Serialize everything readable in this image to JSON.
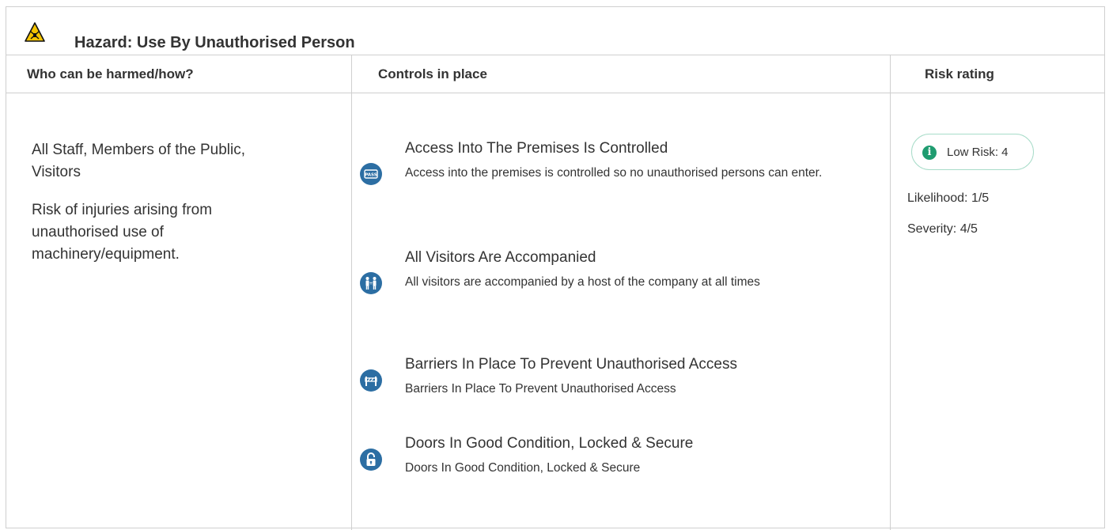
{
  "hazard": {
    "icon": "warning-triangle-icon",
    "title": "Hazard:  Use By Unauthorised Person"
  },
  "columns": {
    "who": "Who can be harmed/how?",
    "controls": "Controls in place",
    "risk": "Risk rating"
  },
  "who": {
    "people": "All Staff, Members of the Public, Visitors",
    "how": "Risk of injuries arising from unauthorised use of machinery/equipment."
  },
  "controls": [
    {
      "icon": "pass-card-icon",
      "title": "Access Into The Premises Is Controlled",
      "description": "Access into the premises is controlled so no unauthorised persons can enter."
    },
    {
      "icon": "accompanied-visitors-icon",
      "title": "All Visitors Are Accompanied",
      "description": "All visitors are accompanied by a host of the company at all times"
    },
    {
      "icon": "barrier-icon",
      "title": "Barriers In Place To Prevent Unauthorised Access",
      "description": "Barriers In Place To Prevent Unauthorised Access"
    },
    {
      "icon": "padlock-icon",
      "title": "Doors In Good Condition, Locked & Secure",
      "description": "Doors In Good Condition, Locked & Secure"
    }
  ],
  "risk": {
    "info_icon": "info-circle-icon",
    "label": "Low Risk: 4",
    "likelihood": "Likelihood: 1/5",
    "severity": "Severity: 4/5",
    "accent_color": "#1f9c70"
  },
  "colors": {
    "icon_blue": "#2c6ea3",
    "border": "#cfcfcf",
    "hazard_yellow": "#f5c400"
  }
}
